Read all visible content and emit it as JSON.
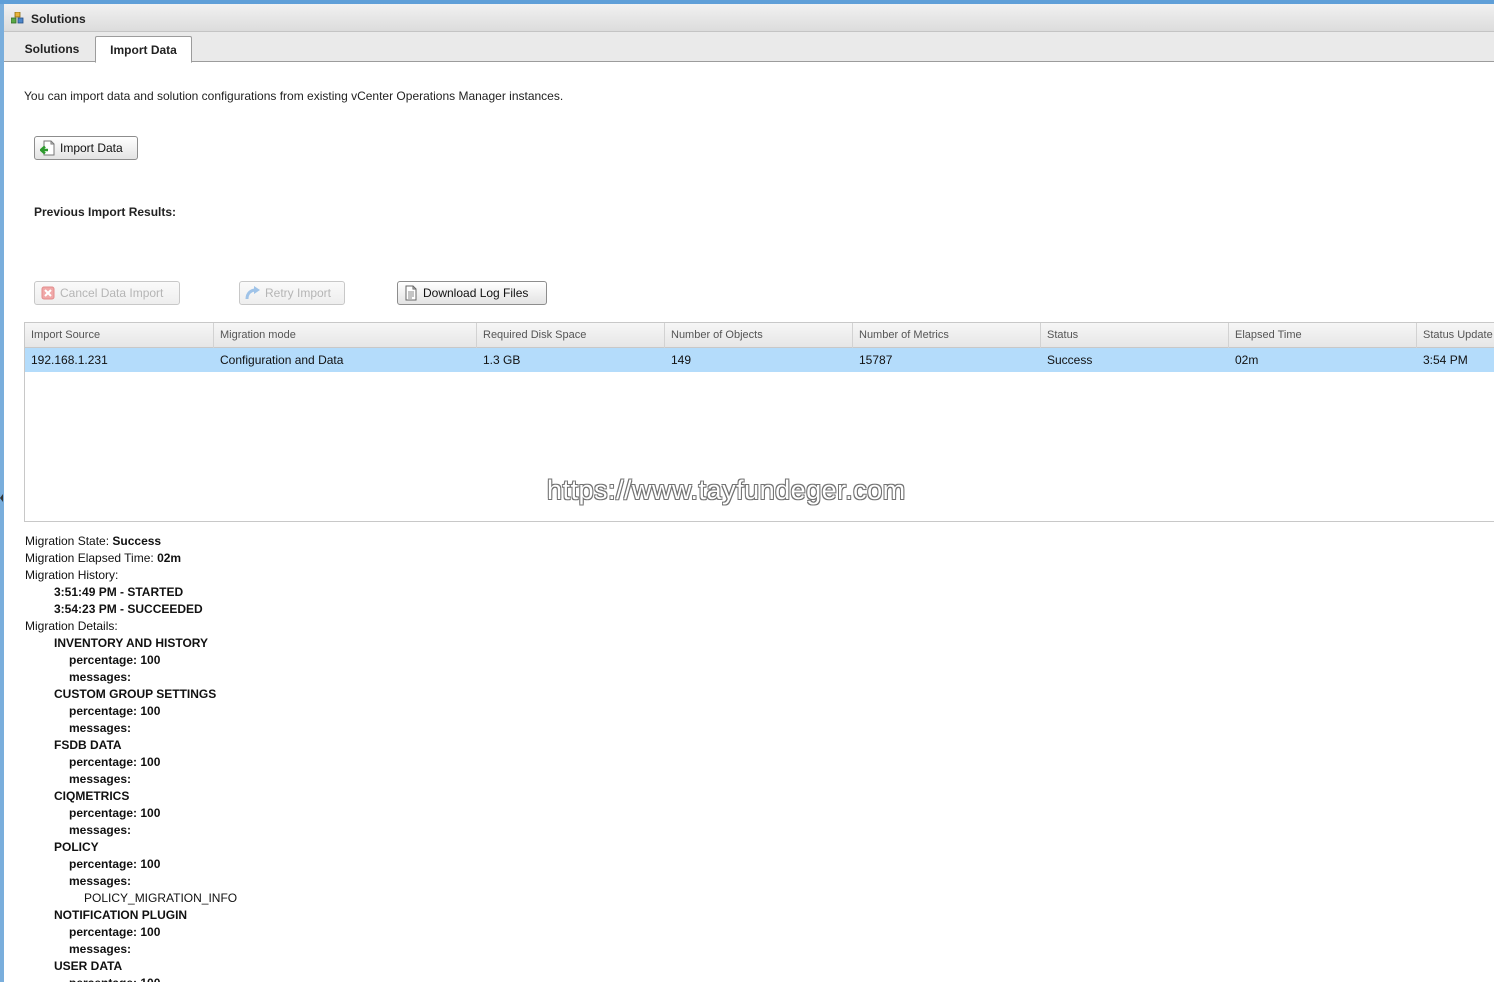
{
  "window": {
    "title": "Solutions"
  },
  "tabs": [
    {
      "label": "Solutions",
      "active": false
    },
    {
      "label": "Import Data",
      "active": true
    }
  ],
  "intro_text": "You can import data and solution configurations from existing vCenter Operations Manager instances.",
  "buttons": {
    "import_data": "Import Data",
    "cancel_import": "Cancel Data Import",
    "retry_import": "Retry Import",
    "download_logs": "Download Log Files"
  },
  "section_heading": "Previous Import Results:",
  "grid": {
    "columns": [
      "Import Source",
      "Migration mode",
      "Required Disk Space",
      "Number of Objects",
      "Number of Metrics",
      "Status",
      "Elapsed Time",
      "Status Update T"
    ],
    "rows": [
      [
        "192.168.1.231",
        "Configuration and Data",
        "1.3 GB",
        "149",
        "15787",
        "Success",
        "02m",
        "3:54 PM"
      ]
    ]
  },
  "watermark": "https://www.tayfundeger.com",
  "details": {
    "state_label": "Migration State:",
    "state_value": "Success",
    "elapsed_label": "Migration Elapsed Time:",
    "elapsed_value": "02m",
    "history_label": "Migration History:",
    "history": [
      "3:51:49 PM - STARTED",
      "3:54:23 PM - SUCCEEDED"
    ],
    "details_label": "Migration Details:",
    "percentage_label": "percentage: 100",
    "messages_label": "messages:",
    "sections": [
      {
        "name": "INVENTORY AND HISTORY",
        "message": ""
      },
      {
        "name": "CUSTOM GROUP SETTINGS",
        "message": ""
      },
      {
        "name": "FSDB DATA",
        "message": ""
      },
      {
        "name": "CIQMETRICS",
        "message": ""
      },
      {
        "name": "POLICY",
        "message": "POLICY_MIGRATION_INFO"
      },
      {
        "name": "NOTIFICATION PLUGIN",
        "message": ""
      },
      {
        "name": "USER DATA",
        "message": ""
      }
    ]
  },
  "colors": {
    "selected_row": "#b4dcfb",
    "top_stripe": "#5f9fd8"
  }
}
